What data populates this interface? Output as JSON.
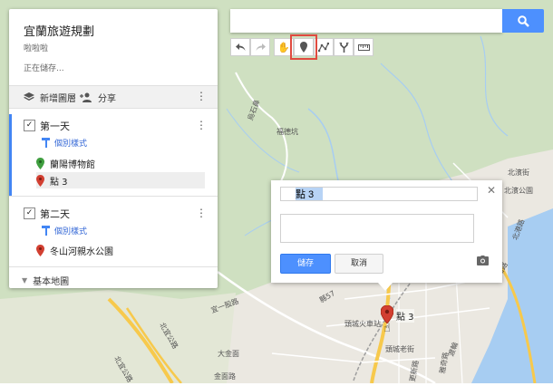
{
  "map": {
    "labels": [
      "烏石鼻",
      "福德坑",
      "北宜公路",
      "宜一股路",
      "北宜公路",
      "大金面",
      "金面路",
      "北濱公園",
      "北濱街",
      "中山路",
      "頭城火車站",
      "頭城老街",
      "縣57",
      "更新路",
      "雅奇路",
      "北港路",
      "渡輪"
    ],
    "marker_label": "點 3"
  },
  "panel": {
    "title": "宜蘭旅遊規劃",
    "description": "啦啦啦",
    "status": "正在儲存...",
    "add_layer": "新增圖層",
    "share": "分享",
    "layers": [
      {
        "name": "第一天",
        "style_label": "個別樣式",
        "features": [
          {
            "name": "蘭陽博物館",
            "color": "#3f9e3f"
          },
          {
            "name": "點 3",
            "color": "#d23f31"
          }
        ]
      },
      {
        "name": "第二天",
        "style_label": "個別樣式",
        "features": [
          {
            "name": "冬山河親水公園",
            "color": "#d23f31"
          }
        ]
      }
    ],
    "base_map": "基本地圖"
  },
  "search": {
    "placeholder": ""
  },
  "popup": {
    "title_value": "點 3",
    "description_value": "",
    "save_label": "儲存",
    "cancel_label": "取消",
    "close_icon": "close-icon",
    "camera_icon": "camera-icon"
  },
  "colors": {
    "accent": "#4d90fe",
    "layer_select": "#4285f4",
    "marker": "#d23f31",
    "toolbar_highlight": "#e04a3f"
  }
}
